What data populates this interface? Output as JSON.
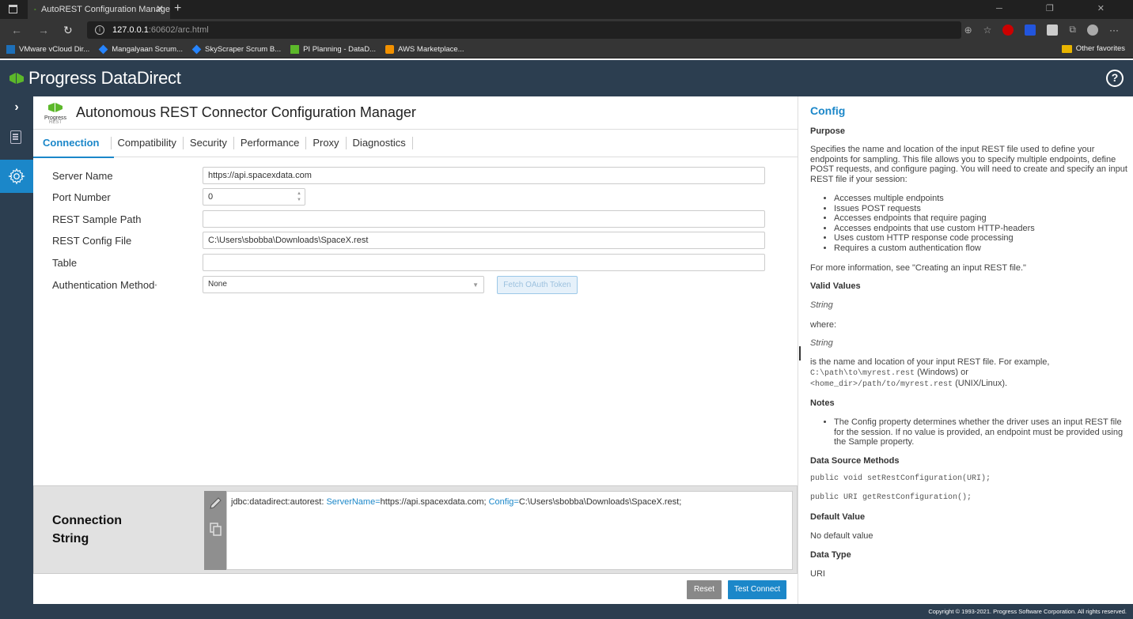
{
  "browser": {
    "tab_title": "AutoREST Configuration Manage",
    "url_host": "127.0.0.1",
    "url_path": ":60602/arc.html",
    "favorites": [
      "VMware vCloud Dir...",
      "Mangalyaan Scrum...",
      "SkyScraper Scrum B...",
      "PI Planning - DataD...",
      "AWS Marketplace..."
    ],
    "other_favorites": "Other favorites"
  },
  "app": {
    "brand": "Progress",
    "brand2": "DataDirect",
    "title": "Autonomous REST Connector Configuration Manager",
    "rest_logo_t1": "Progress",
    "rest_logo_t2": "REST",
    "accent": "#1b87c9",
    "header_bg": "#2c3e50"
  },
  "tabs": [
    "Connection",
    "Compatibility",
    "Security",
    "Performance",
    "Proxy",
    "Diagnostics"
  ],
  "active_tab": "Connection",
  "form": {
    "server_name": {
      "label": "Server Name",
      "value": "https://api.spacexdata.com"
    },
    "port_number": {
      "label": "Port Number",
      "value": "0"
    },
    "rest_sample_path": {
      "label": "REST Sample Path",
      "value": ""
    },
    "rest_config_file": {
      "label": "REST Config File",
      "value": "C:\\Users\\sbobba\\Downloads\\SpaceX.rest"
    },
    "table": {
      "label": "Table",
      "value": ""
    },
    "auth_method": {
      "label": "Authentication Method",
      "required_mark": "*",
      "value": "None"
    },
    "fetch_oauth": "Fetch OAuth Token"
  },
  "connection_string": {
    "label_line1": "Connection",
    "label_line2": "String",
    "prefix": "jdbc:datadirect:autorest: ",
    "key1": "ServerName=",
    "val1": "https://api.spacexdata.com; ",
    "key2": "Config=",
    "val2": "C:\\Users\\sbobba\\Downloads\\SpaceX.rest;"
  },
  "buttons": {
    "reset": "Reset",
    "test_connect": "Test Connect"
  },
  "help": {
    "title": "Config",
    "purpose_h": "Purpose",
    "purpose_p": "Specifies the name and location of the input REST file used to define your endpoints for sampling. This file allows you to specify multiple endpoints, define POST requests, and configure paging. You will need to create and specify an input REST file if your session:",
    "bullets": [
      "Accesses multiple endpoints",
      "Issues POST requests",
      "Accesses endpoints that require paging",
      "Accesses endpoints that use custom HTTP-headers",
      "Uses custom HTTP response code processing",
      "Requires a custom authentication flow"
    ],
    "more_info": "For more information, see \"Creating an input REST file.\"",
    "valid_h": "Valid Values",
    "valid_string": "String",
    "where": "where:",
    "string2": "String",
    "desc_1": "is the name and location of your input REST file. For example,",
    "desc_code1": "C:\\path\\to\\myrest.rest",
    "desc_2": " (Windows) or",
    "desc_code2": "<home_dir>/path/to/myrest.rest",
    "desc_3": " (UNIX/Linux).",
    "notes_h": "Notes",
    "notes_item": "The Config property determines whether the driver uses an input REST file for the session. If no value is provided, an endpoint must be provided using the Sample property.",
    "dsm_h": "Data Source Methods",
    "dsm_1": "public void setRestConfiguration(URI);",
    "dsm_2": "public URI getRestConfiguration();",
    "default_h": "Default Value",
    "default_v": "No default value",
    "type_h": "Data Type",
    "type_v": "URI"
  },
  "footer": "Copyright © 1993-2021. Progress Software Corporation. All rights reserved."
}
